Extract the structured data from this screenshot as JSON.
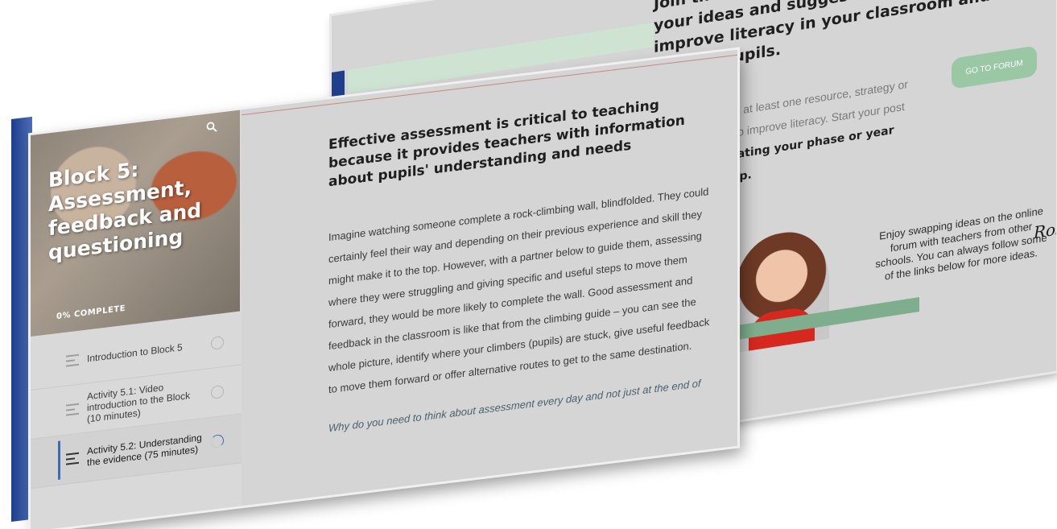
{
  "forum": {
    "heading": "Join the online discussion forum to share your ideas and suggestions for how to improve literacy in your classroom and early literate pupils.",
    "body_text": "Share at least one resource, strategy or idea to improve literacy. Start your post by",
    "body_strong": "stating your phase or year group.",
    "go_button_label": "GO TO FORUM",
    "enjoy_text": "Enjoy swapping ideas on the online forum with teachers from other schools. You can always follow some of the links below for more ideas.",
    "signature": "Rose"
  },
  "course": {
    "block_title": "Block 5: Assessment, feedback and questioning",
    "progress_text": "0% COMPLETE",
    "search_icon": "search-icon",
    "nav_items": [
      {
        "label": "Introduction to Block 5",
        "status": "not-started"
      },
      {
        "label": "Activity 5.1: Video introduction to the Block (10 minutes)",
        "status": "not-started"
      },
      {
        "label": "Activity 5.2: Understanding the evidence (75 minutes)",
        "status": "in-progress",
        "active": true
      }
    ]
  },
  "lesson": {
    "heading": "Effective assessment is critical to teaching because it provides teachers with information about pupils' understanding and needs",
    "body": "Imagine watching someone complete a rock-climbing wall, blindfolded. They could certainly feel their way and depending on their previous experience and skill they might make it to the top. However, with a partner below to guide them, assessing where they were struggling and giving specific and useful steps to move them forward, they would be more likely to complete the wall. Good assessment and feedback in the classroom is like that from the climbing guide – you can see the whole picture, identify where your climbers (pupils) are stuck, give useful feedback to move them forward or offer alternative routes to get to the same destination.",
    "question": "Why do you need to think about assessment every day and not just at the end of"
  },
  "colors": {
    "accent_blue": "#1f3f8a",
    "forum_button": "#9bc8a4",
    "panel_bg": "#d5d5d5"
  }
}
